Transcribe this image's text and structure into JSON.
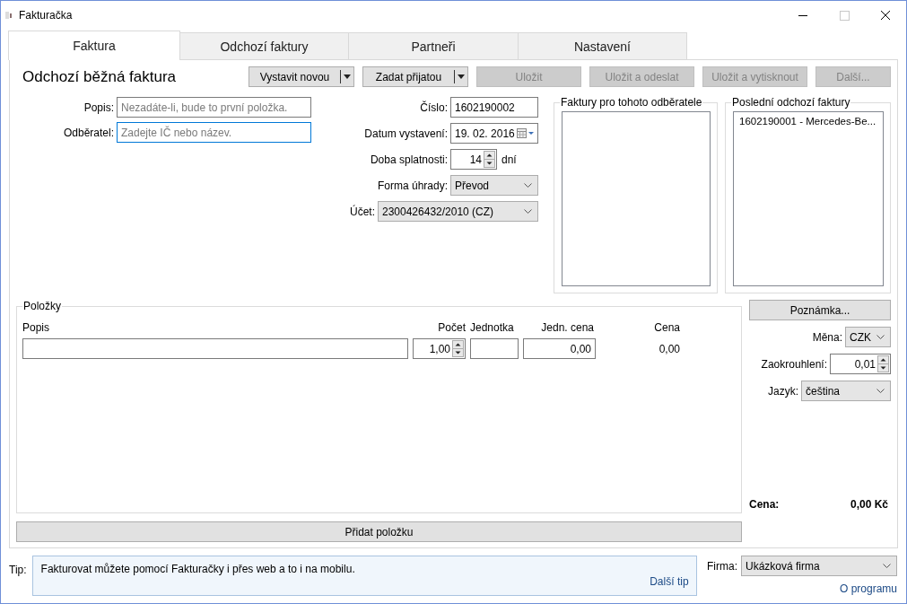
{
  "window": {
    "title": "Fakturačka"
  },
  "tabs": [
    {
      "label": "Faktura",
      "selected": true
    },
    {
      "label": "Odchozí faktury",
      "selected": false
    },
    {
      "label": "Partneři",
      "selected": false
    },
    {
      "label": "Nastavení",
      "selected": false
    }
  ],
  "header": {
    "title": "Odchozí běžná faktura",
    "buttons": [
      {
        "label": "Vystavit novou",
        "kind": "split",
        "disabled": false
      },
      {
        "label": "Zadat přijatou",
        "kind": "split",
        "disabled": false
      },
      {
        "label": "Uložit",
        "kind": "plain",
        "disabled": true
      },
      {
        "label": "Uložit a odeslat",
        "kind": "plain",
        "disabled": true
      },
      {
        "label": "Uložit a vytisknout",
        "kind": "plain",
        "disabled": true
      },
      {
        "label": "Další...",
        "kind": "plain",
        "disabled": true
      }
    ]
  },
  "fields": [
    {
      "label": "Popis:",
      "placeholder": "Nezadáte-li, bude to první položka.",
      "focused": false
    },
    {
      "label": "Odběratel:",
      "placeholder": "Zadejte IČ nebo název.",
      "focused": true
    }
  ],
  "invoice_fields": [
    {
      "kind": "text",
      "label": "Číslo:",
      "value": "1602190002"
    },
    {
      "kind": "date",
      "label": "Datum vystavení:",
      "value": "19. 02. 2016"
    },
    {
      "kind": "spinner",
      "label": "Doba splatnosti:",
      "value": "14",
      "unit": "dní"
    },
    {
      "kind": "select",
      "label": "Forma úhrady:",
      "value": "Převod"
    },
    {
      "kind": "select",
      "label": "Účet:",
      "value": "2300426432/2010 (CZ)"
    }
  ],
  "customer_invoices": {
    "title": "Faktury pro tohoto odběratele"
  },
  "recent_invoices": {
    "title": "Poslední odchozí faktury",
    "items": [
      "1602190001 - Mercedes-Be..."
    ]
  },
  "items": {
    "title": "Položky",
    "columns": [
      "Popis",
      "Počet",
      "Jednotka",
      "Jedn. cena",
      "Cena"
    ],
    "rows": [
      {
        "quantity": "1,00",
        "unit_price": "0,00",
        "price": "0,00"
      }
    ]
  },
  "note_button": "Poznámka...",
  "settings": [
    {
      "kind": "select",
      "label": "Měna:",
      "value": "CZK"
    },
    {
      "kind": "spinner",
      "label": "Zaokrouhlení:",
      "value": "0,01"
    },
    {
      "kind": "select",
      "label": "Jazyk:",
      "value": "čeština"
    }
  ],
  "total": {
    "label": "Cena:",
    "value": "0,00 Kč"
  },
  "add_item_button": "Přidat položku",
  "tip": {
    "label": "Tip:",
    "text": "Fakturovat můžete pomocí Fakturačky i přes web a to i na mobilu.",
    "next": "Další tip"
  },
  "company": {
    "label": "Firma:",
    "value": "Ukázková firma"
  },
  "about_link": "O programu"
}
